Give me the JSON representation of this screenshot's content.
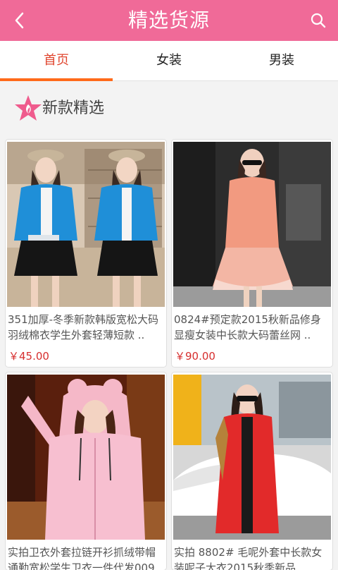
{
  "header": {
    "title": "精选货源",
    "back_icon": "chevron-left-icon",
    "search_icon": "search-icon"
  },
  "tabs": [
    {
      "label": "首页",
      "active": true
    },
    {
      "label": "女装",
      "active": false
    },
    {
      "label": "男装",
      "active": false
    }
  ],
  "section": {
    "title": "新款精选",
    "icon": "star-icon"
  },
  "products": [
    {
      "name": "351加厚-冬季新款韩版宽松大码羽绒棉衣学生外套轻薄短款 ..",
      "price": "￥45.00"
    },
    {
      "name": "0824#预定款2015秋新品修身显瘦女装中长款大码蕾丝网 ..",
      "price": "￥90.00"
    },
    {
      "name": "实拍卫衣外套拉链开衫抓绒带帽通勤宽松学生卫衣一件代发009",
      "price": ""
    },
    {
      "name": "实拍 8802# 毛呢外套中长款女装呢子大衣2015秋季新品",
      "price": ""
    }
  ],
  "colors": {
    "brand": "#f06a98",
    "tab_active": "#e0452e",
    "tab_underline": "#ff6a1a",
    "price": "#d62e2e"
  }
}
